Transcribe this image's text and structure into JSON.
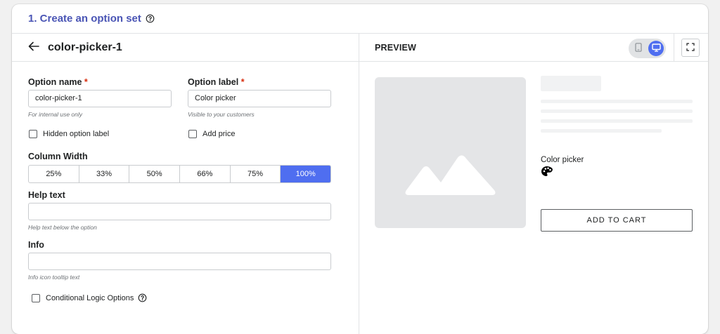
{
  "header": {
    "title": "1. Create an option set"
  },
  "editor": {
    "set_name": "color-picker-1",
    "option_name": {
      "label": "Option name",
      "required_mark": "*",
      "value": "color-picker-1",
      "hint": "For internal use only"
    },
    "option_label": {
      "label": "Option label",
      "required_mark": "*",
      "value": "Color picker",
      "hint": "Visible to your customers"
    },
    "hidden_option_label": {
      "label": "Hidden option label",
      "checked": false
    },
    "add_price": {
      "label": "Add price",
      "checked": false
    },
    "column_width": {
      "label": "Column Width",
      "options": [
        "25%",
        "33%",
        "50%",
        "66%",
        "75%",
        "100%"
      ],
      "selected": "100%"
    },
    "help_text": {
      "label": "Help text",
      "value": "",
      "hint": "Help text below the option"
    },
    "info": {
      "label": "Info",
      "value": "",
      "hint": "Info icon tooltip text"
    },
    "conditional_logic": {
      "label": "Conditional Logic Options",
      "checked": false
    }
  },
  "preview": {
    "title": "PREVIEW",
    "device_selected": "desktop",
    "option_label": "Color picker",
    "add_to_cart_label": "ADD TO CART"
  },
  "colors": {
    "accent": "#4f6ef0",
    "title": "#4a55b5",
    "required": "#d72c0d"
  }
}
